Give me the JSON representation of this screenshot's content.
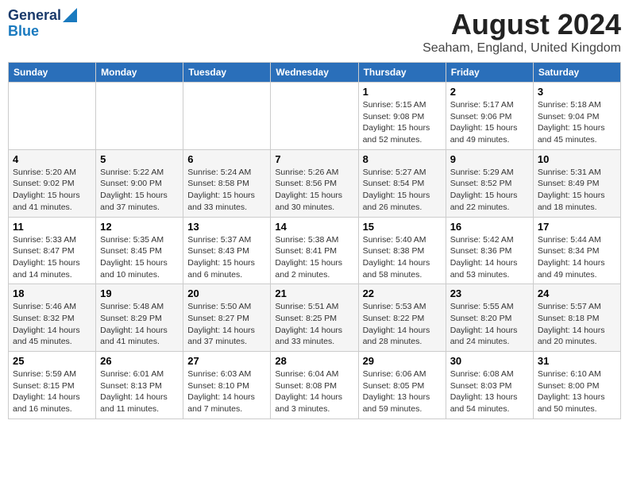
{
  "header": {
    "logo_line1": "General",
    "logo_line2": "Blue",
    "title": "August 2024",
    "subtitle": "Seaham, England, United Kingdom"
  },
  "days_of_week": [
    "Sunday",
    "Monday",
    "Tuesday",
    "Wednesday",
    "Thursday",
    "Friday",
    "Saturday"
  ],
  "weeks": [
    [
      {
        "day": "",
        "info": ""
      },
      {
        "day": "",
        "info": ""
      },
      {
        "day": "",
        "info": ""
      },
      {
        "day": "",
        "info": ""
      },
      {
        "day": "1",
        "info": "Sunrise: 5:15 AM\nSunset: 9:08 PM\nDaylight: 15 hours\nand 52 minutes."
      },
      {
        "day": "2",
        "info": "Sunrise: 5:17 AM\nSunset: 9:06 PM\nDaylight: 15 hours\nand 49 minutes."
      },
      {
        "day": "3",
        "info": "Sunrise: 5:18 AM\nSunset: 9:04 PM\nDaylight: 15 hours\nand 45 minutes."
      }
    ],
    [
      {
        "day": "4",
        "info": "Sunrise: 5:20 AM\nSunset: 9:02 PM\nDaylight: 15 hours\nand 41 minutes."
      },
      {
        "day": "5",
        "info": "Sunrise: 5:22 AM\nSunset: 9:00 PM\nDaylight: 15 hours\nand 37 minutes."
      },
      {
        "day": "6",
        "info": "Sunrise: 5:24 AM\nSunset: 8:58 PM\nDaylight: 15 hours\nand 33 minutes."
      },
      {
        "day": "7",
        "info": "Sunrise: 5:26 AM\nSunset: 8:56 PM\nDaylight: 15 hours\nand 30 minutes."
      },
      {
        "day": "8",
        "info": "Sunrise: 5:27 AM\nSunset: 8:54 PM\nDaylight: 15 hours\nand 26 minutes."
      },
      {
        "day": "9",
        "info": "Sunrise: 5:29 AM\nSunset: 8:52 PM\nDaylight: 15 hours\nand 22 minutes."
      },
      {
        "day": "10",
        "info": "Sunrise: 5:31 AM\nSunset: 8:49 PM\nDaylight: 15 hours\nand 18 minutes."
      }
    ],
    [
      {
        "day": "11",
        "info": "Sunrise: 5:33 AM\nSunset: 8:47 PM\nDaylight: 15 hours\nand 14 minutes."
      },
      {
        "day": "12",
        "info": "Sunrise: 5:35 AM\nSunset: 8:45 PM\nDaylight: 15 hours\nand 10 minutes."
      },
      {
        "day": "13",
        "info": "Sunrise: 5:37 AM\nSunset: 8:43 PM\nDaylight: 15 hours\nand 6 minutes."
      },
      {
        "day": "14",
        "info": "Sunrise: 5:38 AM\nSunset: 8:41 PM\nDaylight: 15 hours\nand 2 minutes."
      },
      {
        "day": "15",
        "info": "Sunrise: 5:40 AM\nSunset: 8:38 PM\nDaylight: 14 hours\nand 58 minutes."
      },
      {
        "day": "16",
        "info": "Sunrise: 5:42 AM\nSunset: 8:36 PM\nDaylight: 14 hours\nand 53 minutes."
      },
      {
        "day": "17",
        "info": "Sunrise: 5:44 AM\nSunset: 8:34 PM\nDaylight: 14 hours\nand 49 minutes."
      }
    ],
    [
      {
        "day": "18",
        "info": "Sunrise: 5:46 AM\nSunset: 8:32 PM\nDaylight: 14 hours\nand 45 minutes."
      },
      {
        "day": "19",
        "info": "Sunrise: 5:48 AM\nSunset: 8:29 PM\nDaylight: 14 hours\nand 41 minutes."
      },
      {
        "day": "20",
        "info": "Sunrise: 5:50 AM\nSunset: 8:27 PM\nDaylight: 14 hours\nand 37 minutes."
      },
      {
        "day": "21",
        "info": "Sunrise: 5:51 AM\nSunset: 8:25 PM\nDaylight: 14 hours\nand 33 minutes."
      },
      {
        "day": "22",
        "info": "Sunrise: 5:53 AM\nSunset: 8:22 PM\nDaylight: 14 hours\nand 28 minutes."
      },
      {
        "day": "23",
        "info": "Sunrise: 5:55 AM\nSunset: 8:20 PM\nDaylight: 14 hours\nand 24 minutes."
      },
      {
        "day": "24",
        "info": "Sunrise: 5:57 AM\nSunset: 8:18 PM\nDaylight: 14 hours\nand 20 minutes."
      }
    ],
    [
      {
        "day": "25",
        "info": "Sunrise: 5:59 AM\nSunset: 8:15 PM\nDaylight: 14 hours\nand 16 minutes."
      },
      {
        "day": "26",
        "info": "Sunrise: 6:01 AM\nSunset: 8:13 PM\nDaylight: 14 hours\nand 11 minutes."
      },
      {
        "day": "27",
        "info": "Sunrise: 6:03 AM\nSunset: 8:10 PM\nDaylight: 14 hours\nand 7 minutes."
      },
      {
        "day": "28",
        "info": "Sunrise: 6:04 AM\nSunset: 8:08 PM\nDaylight: 14 hours\nand 3 minutes."
      },
      {
        "day": "29",
        "info": "Sunrise: 6:06 AM\nSunset: 8:05 PM\nDaylight: 13 hours\nand 59 minutes."
      },
      {
        "day": "30",
        "info": "Sunrise: 6:08 AM\nSunset: 8:03 PM\nDaylight: 13 hours\nand 54 minutes."
      },
      {
        "day": "31",
        "info": "Sunrise: 6:10 AM\nSunset: 8:00 PM\nDaylight: 13 hours\nand 50 minutes."
      }
    ]
  ]
}
